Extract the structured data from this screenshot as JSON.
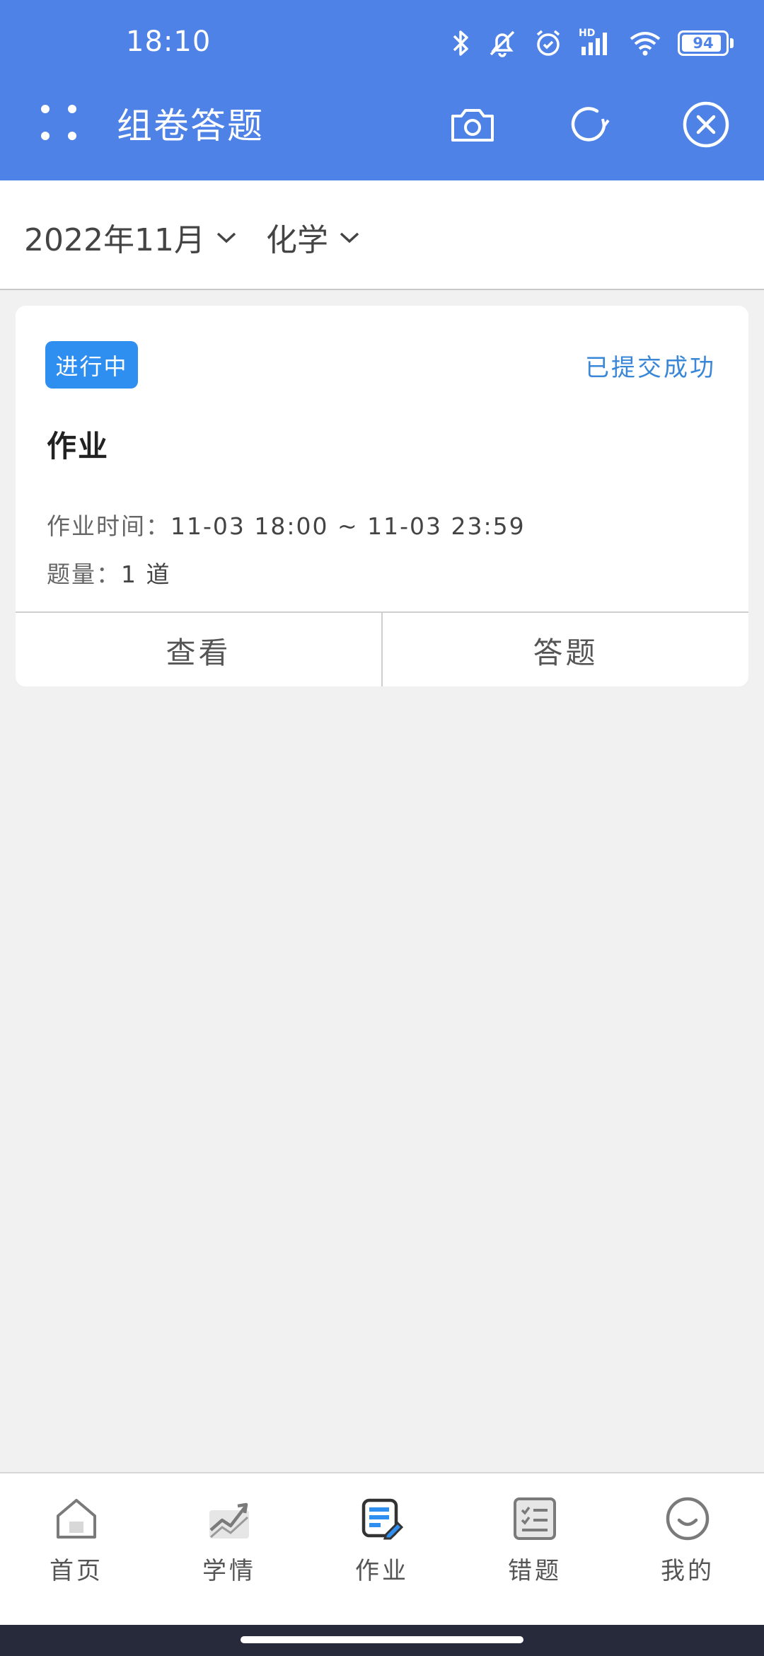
{
  "status_bar": {
    "time": "18:10",
    "hd_label": "HD",
    "battery": "94",
    "icons": [
      "bluetooth-icon",
      "mute-icon",
      "alarm-icon",
      "signal-icon",
      "wifi-icon",
      "battery-icon"
    ]
  },
  "header": {
    "title": "组卷答题",
    "icons": [
      "menu-dots-icon",
      "camera-icon",
      "refresh-icon",
      "close-circle-icon"
    ]
  },
  "filters": {
    "date": "2022年11月",
    "subject": "化学"
  },
  "assignment": {
    "status_badge": "进行中",
    "submit_status": "已提交成功",
    "title": "作业",
    "time_label": "作业时间：",
    "time_value": "11-03 18:00 ~ 11-03 23:59",
    "count_label": "题量：",
    "count_value": "1 道",
    "view_label": "查看",
    "answer_label": "答题"
  },
  "bottom_nav": {
    "items": [
      {
        "label": "首页",
        "icon": "home-icon"
      },
      {
        "label": "学情",
        "icon": "trend-chart-icon"
      },
      {
        "label": "作业",
        "icon": "homework-edit-icon"
      },
      {
        "label": "错题",
        "icon": "checklist-icon"
      },
      {
        "label": "我的",
        "icon": "smiley-icon"
      }
    ],
    "active_index": 2
  },
  "colors": {
    "header_bg": "#4e82e6",
    "badge_bg": "#2f8ff0",
    "submit_text": "#3a87d8",
    "active_nav": "#2f8ff0"
  }
}
